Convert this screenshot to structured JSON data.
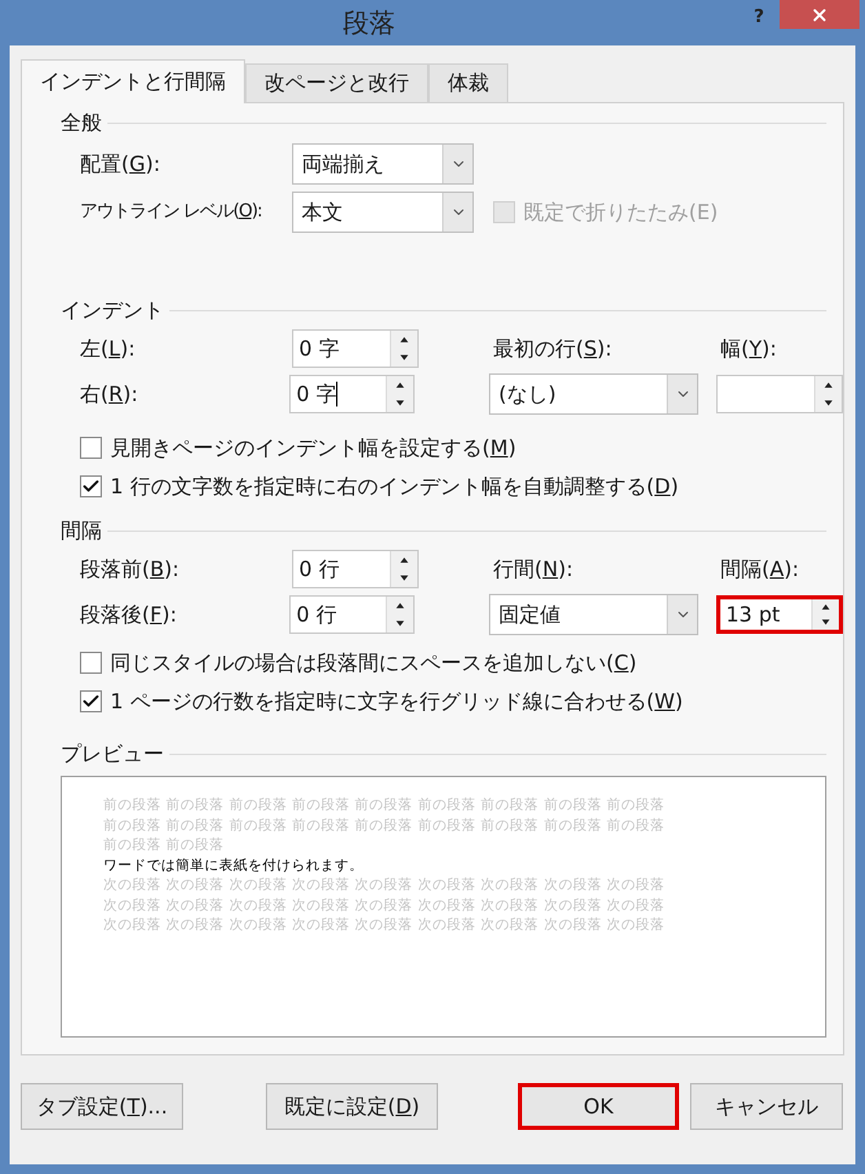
{
  "window": {
    "title": "段落",
    "help": "?"
  },
  "tabs": [
    {
      "label": "インデントと行間隔",
      "selected": true
    },
    {
      "label": "改ページと改行",
      "selected": false
    },
    {
      "label": "体裁",
      "selected": false
    }
  ],
  "general": {
    "heading": "全般",
    "alignment": {
      "label": [
        "配置(",
        "G",
        "):"
      ],
      "value": "両端揃え"
    },
    "outline_level": {
      "label": [
        "アウトライン レベル(",
        "O",
        "):"
      ],
      "value": "本文"
    },
    "collapse": {
      "label": [
        "既定で折りたたみ(E)"
      ],
      "checked": false,
      "disabled": true
    }
  },
  "indent": {
    "heading": "インデント",
    "left": {
      "label": [
        "左(",
        "L",
        "):"
      ],
      "value": "0 字",
      "focused": false
    },
    "right": {
      "label": [
        "右(",
        "R",
        "):"
      ],
      "value": "0 字",
      "focused": true
    },
    "first_line": {
      "label": [
        "最初の行(",
        "S",
        "):"
      ],
      "value": "(なし)"
    },
    "by": {
      "label": [
        "幅(",
        "Y",
        "):"
      ]
    },
    "options": [
      {
        "label": [
          "見開きページのインデント幅を設定する(",
          "M",
          ")"
        ],
        "checked": false,
        "disabled": false
      },
      {
        "label": [
          "1 行の文字数を指定時に右のインデント幅を自動調整する(",
          "D",
          ")"
        ],
        "checked": true,
        "disabled": false
      }
    ]
  },
  "spacing": {
    "heading": "間隔",
    "before": {
      "label": [
        "段落前(",
        "B",
        "):"
      ],
      "value": "0 行",
      "highlighted": false
    },
    "after": {
      "label": [
        "段落後(",
        "F",
        "):"
      ],
      "value": "0 行",
      "highlighted": false
    },
    "line_spacing": {
      "label": [
        "行間(",
        "N",
        "):"
      ],
      "value": "固定値"
    },
    "at": {
      "label": [
        "間隔(",
        "A",
        "):"
      ],
      "value": "13 pt",
      "highlighted": true
    },
    "options": [
      {
        "label": [
          "同じスタイルの場合は段落間にスペースを追加しない(",
          "C",
          ")"
        ],
        "checked": false,
        "disabled": false
      },
      {
        "label": [
          "1 ページの行数を指定時に文字を行グリッド線に合わせる(",
          "W",
          ")"
        ],
        "checked": true,
        "disabled": false
      }
    ]
  },
  "preview": {
    "heading": "プレビュー",
    "lines": [
      {
        "kind": "context",
        "text": "前の段落 前の段落 前の段落 前の段落 前の段落 前の段落 前の段落 前の段落 前の段落"
      },
      {
        "kind": "context",
        "text": "前の段落 前の段落 前の段落 前の段落 前の段落 前の段落 前の段落 前の段落 前の段落"
      },
      {
        "kind": "context",
        "text": "前の段落 前の段落"
      },
      {
        "kind": "current",
        "text": "ワードでは簡単に表紙を付けられます。"
      },
      {
        "kind": "context",
        "text": "次の段落 次の段落 次の段落 次の段落 次の段落 次の段落 次の段落 次の段落 次の段落"
      },
      {
        "kind": "context",
        "text": "次の段落 次の段落 次の段落 次の段落 次の段落 次の段落 次の段落 次の段落 次の段落"
      },
      {
        "kind": "context",
        "text": "次の段落 次の段落 次の段落 次の段落 次の段落 次の段落 次の段落 次の段落 次の段落"
      }
    ]
  },
  "buttons": [
    {
      "label": [
        "タブ設定(",
        "T",
        ")..."
      ],
      "highlighted": false
    },
    {
      "label": [
        "既定に設定(",
        "D",
        ")"
      ],
      "highlighted": false
    },
    {
      "label": [
        "OK"
      ],
      "highlighted": true
    },
    {
      "label": [
        "キャンセル"
      ],
      "highlighted": false
    }
  ]
}
